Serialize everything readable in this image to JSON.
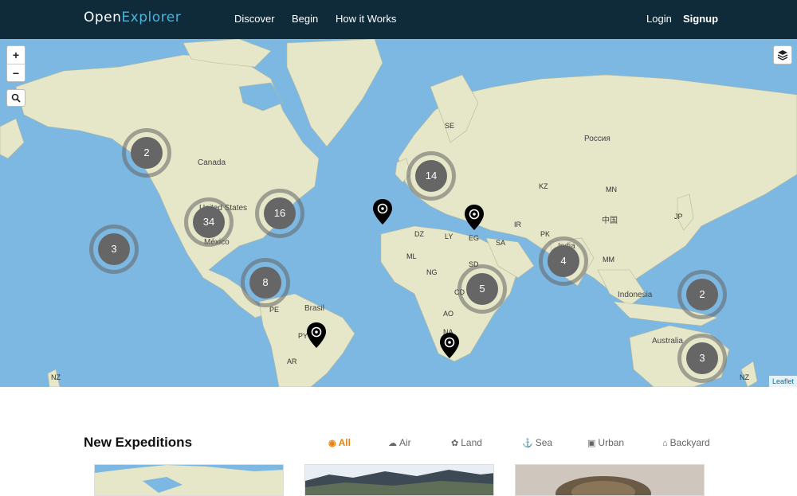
{
  "header": {
    "logo_open": "Open",
    "logo_explorer": "Explorer",
    "nav": [
      "Discover",
      "Begin",
      "How it Works"
    ],
    "login": "Login",
    "signup": "Signup"
  },
  "map": {
    "zoom_in": "+",
    "zoom_out": "−",
    "search_icon": "search-icon",
    "layers_icon": "layers-icon",
    "attribution": "Leaflet",
    "labels": {
      "canada": "Canada",
      "united_states": "United States",
      "mexico": "México",
      "brasil": "Brasil",
      "russia": "Россия",
      "china": "中国",
      "india": "India",
      "indonesia": "Indonesia",
      "australia": "Australia",
      "se": "SE",
      "kz": "KZ",
      "mn": "MN",
      "jp": "JP",
      "ir": "IR",
      "pk": "PK",
      "dz": "DZ",
      "ly": "LY",
      "eg": "EG",
      "sa": "SA",
      "ml": "ML",
      "ng": "NG",
      "sd": "SD",
      "ao": "AO",
      "na": "NA",
      "pe": "PE",
      "py": "PY",
      "ar": "AR",
      "nz_left": "NZ",
      "nz_right": "NZ",
      "mm": "MM",
      "cd": "CD"
    },
    "clusters": [
      {
        "count": "2"
      },
      {
        "count": "34"
      },
      {
        "count": "16"
      },
      {
        "count": "3"
      },
      {
        "count": "8"
      },
      {
        "count": "14"
      },
      {
        "count": "5"
      },
      {
        "count": "4"
      },
      {
        "count": "2"
      },
      {
        "count": "3"
      }
    ]
  },
  "expeditions": {
    "title": "New Expeditions",
    "filters": [
      {
        "label": "All",
        "icon": "globe-icon"
      },
      {
        "label": "Air",
        "icon": "cloud-icon"
      },
      {
        "label": "Land",
        "icon": "leaf-icon"
      },
      {
        "label": "Sea",
        "icon": "anchor-icon"
      },
      {
        "label": "Urban",
        "icon": "building-icon"
      },
      {
        "label": "Backyard",
        "icon": "home-icon"
      }
    ],
    "active_color": "#e8820f"
  }
}
